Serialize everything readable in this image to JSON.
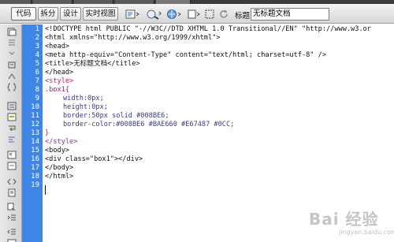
{
  "toolbar": {
    "code_label": "代码",
    "split_label": "拆分",
    "design_label": "设计",
    "live_view_label": "实时视图",
    "title_label": "标题:",
    "title_value": "无标题文档",
    "icons": [
      "live-code-icon",
      "inspect-icon",
      "browser-preview-icon",
      "file-management-icon",
      "visual-aids-icon",
      "refresh-icon"
    ]
  },
  "sidebar": {
    "icons": [
      "open-documents-icon",
      "collapse-full-tag-icon",
      "collapse-selection-icon",
      "expand-all-icon",
      "select-parent-tag-icon",
      "balance-braces-icon",
      "line-numbers-icon",
      "highlight-invalid-code-icon",
      "word-wrap-icon",
      "syntax-coloring-icon",
      "apply-comment-icon",
      "remove-comment-icon",
      "wrap-tag-icon",
      "recent-snippets-icon",
      "move-css-icon",
      "indent-code-icon",
      "outdent-code-icon",
      "format-source-icon"
    ]
  },
  "gutter": {
    "line_numbers": [
      "1",
      "2",
      "3",
      "4",
      "5",
      "6",
      "7",
      "8",
      "9",
      "10",
      "11",
      "12",
      "13",
      "14",
      "15",
      "16",
      "17",
      "18",
      "19"
    ]
  },
  "code": {
    "lines": [
      "<!DOCTYPE html PUBLIC \"-//W3C//DTD XHTML 1.0 Transitional//EN\" \"http://www.w3.or",
      "<html xmlns=\"http://www.w3.org/1999/xhtml\">",
      "<head>",
      "<meta http-equiv=\"Content-Type\" content=\"text/html; charset=utf-8\" />",
      "<title>无标题文档</title>",
      "</head>",
      "<style>",
      ".box1{",
      "width:0px;",
      "height:0px;",
      "border:50px solid #008BE6;",
      "border-color:#008BE6 #BAE660 #E67487 #0CC;",
      "}",
      "</style>",
      "<body>",
      "<div class=\"box1\"></div>",
      "</body>",
      "</html>",
      ""
    ]
  },
  "watermark": {
    "text": "Bai 经验",
    "sub": "jingyan.baidu.com"
  },
  "colors": {
    "gutter": "#3d86e6",
    "css_selector": "#b4207a",
    "css_property": "#3a3a8a"
  }
}
